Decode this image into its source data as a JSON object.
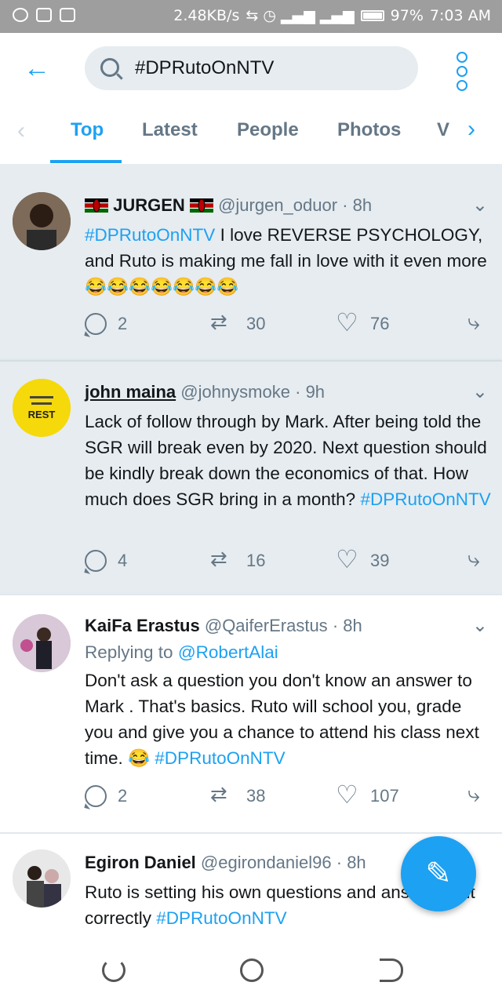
{
  "status_bar": {
    "speed": "2.48KB/s",
    "battery": "97%",
    "time": "7:03 AM"
  },
  "search": {
    "query": "#DPRutoOnNTV"
  },
  "tabs": [
    {
      "label": "Top"
    },
    {
      "label": "Latest"
    },
    {
      "label": "People"
    },
    {
      "label": "Photos"
    },
    {
      "label": "V"
    }
  ],
  "tweets": [
    {
      "name": "JURGEN",
      "handle": "@jurgen_oduor",
      "time": "8h",
      "hashtag": "#DPRutoOnNTV",
      "text": " I love REVERSE PSYCHOLOGY, and Ruto is making me fall in love with it even more ",
      "emoji": "😂😂😂😂😂😂😂",
      "replies": "2",
      "retweets": "30",
      "likes": "76"
    },
    {
      "name": "john maina",
      "handle": "@johnysmoke",
      "time": "9h",
      "text": "Lack of follow through by Mark. After being told the SGR will break even by 2020. Next question should be kindly break down the economics of that. How much does SGR bring in a month? ",
      "hashtag": "#DPRutoOnNTV",
      "avatar_label": "REST",
      "replies": "4",
      "retweets": "16",
      "likes": "39"
    },
    {
      "name": "KaiFa Erastus",
      "handle": "@QaiferErastus",
      "time": "8h",
      "replying_prefix": "Replying to ",
      "replying_to": "@RobertAlai",
      "text": "Don't ask a question you don't know an answer to Mark . That's basics. Ruto will school you, grade you and give you a chance to attend his class next time. ",
      "emoji": "😂",
      "hashtag": "#DPRutoOnNTV",
      "replies": "2",
      "retweets": "38",
      "likes": "107"
    },
    {
      "name": "Egiron Daniel",
      "handle": "@egirondaniel96",
      "time": "8h",
      "text": "Ruto is setting his own questions and answering it correctly ",
      "hashtag": "#DPRutoOnNTV"
    }
  ],
  "colors": {
    "accent": "#1da1f2",
    "muted": "#657786",
    "bg_grey": "#e6ecf0"
  }
}
